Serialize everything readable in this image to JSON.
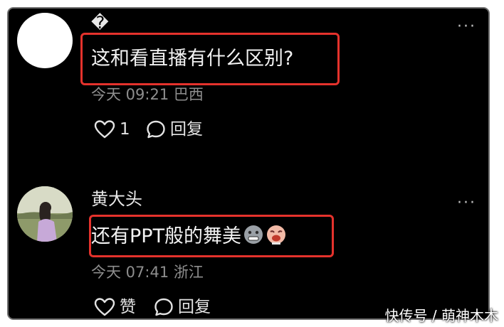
{
  "comments": [
    {
      "username": "�",
      "text": "这和看直播有什么区别?",
      "meta": "今天 09:21 巴西",
      "like_label": "1",
      "reply_label": "回复"
    },
    {
      "username": "黄大头",
      "text": "还有PPT般的舞美",
      "meta": "今天 07:41 浙江",
      "like_label": "赞",
      "reply_label": "回复"
    }
  ],
  "more_label": "···",
  "watermark": "快传号 / 萌神木木",
  "colors": {
    "background": "#000000",
    "highlight": "#e5322c",
    "meta_text": "#8e8e8e"
  }
}
